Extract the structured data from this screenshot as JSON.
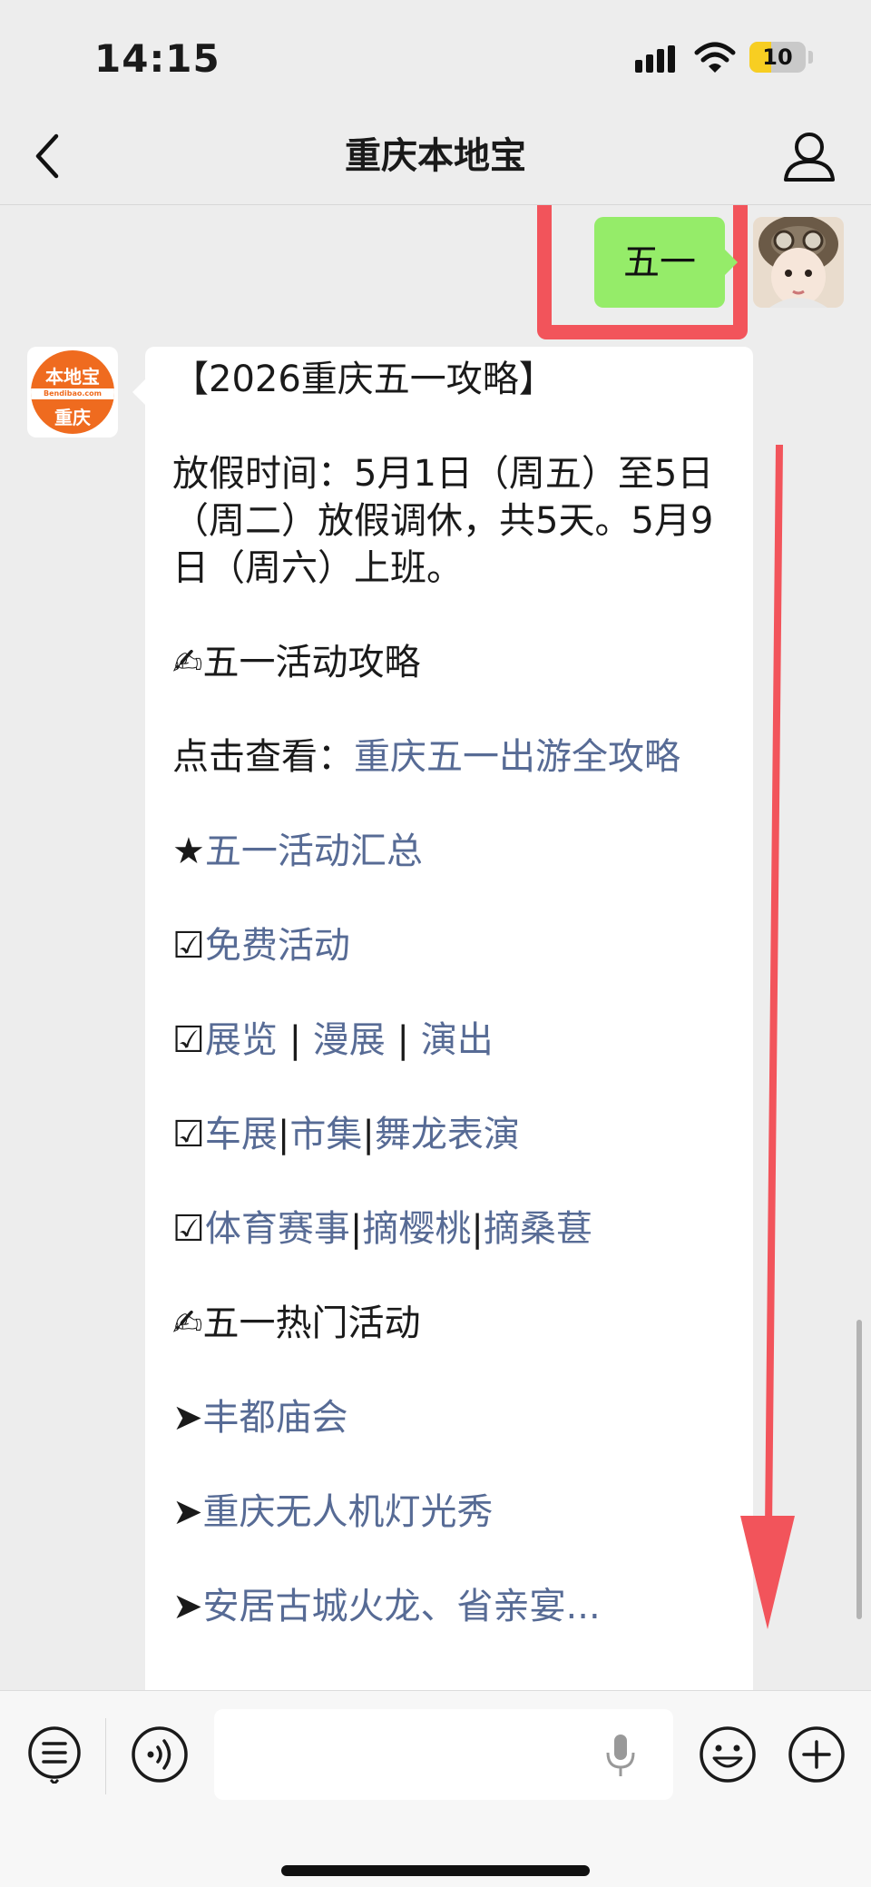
{
  "status": {
    "time": "14:15",
    "battery": "10"
  },
  "nav": {
    "title": "重庆本地宝"
  },
  "sent": {
    "text": "五一"
  },
  "bot": {
    "avatar_brand": "本地宝",
    "avatar_url": "Bendibao.com",
    "avatar_city": "重庆"
  },
  "message": {
    "title": "【2026重庆五一攻略】",
    "holiday": "放假时间：5月1日（周五）至5日（周二）放假调休，共5天。5月9日（周六）上班。",
    "holiday_lines": [
      "放假时间：5月1日（周五）至5日",
      "（周二）放假调休，共5天。5月9",
      "日（周六）上班。"
    ],
    "section1": "✍五一活动攻略",
    "guide_prefix": "点击查看：",
    "guide_link": "重庆五一出游全攻略",
    "star_prefix": "★",
    "star_link": "五一活动汇总",
    "check": "☑",
    "free_link": "免费活动",
    "exhibit_links": [
      "展览",
      "漫展",
      "演出"
    ],
    "car_links": [
      "车展",
      "市集",
      "舞龙表演"
    ],
    "sport_links": [
      "体育赛事",
      "摘樱桃",
      "摘桑葚"
    ],
    "separator": "|",
    "section2": "✍五一热门活动",
    "arrow": "➤",
    "hot_links": [
      "丰都庙会",
      "重庆无人机灯光秀",
      "安居古城火龙、省亲宴..."
    ]
  },
  "colors": {
    "link": "#576b95",
    "sent_bubble": "#95ec69",
    "annotation": "#f2545b",
    "background": "#ededed"
  },
  "icons": [
    "back-icon",
    "profile-icon",
    "menu-icon",
    "voice-icon",
    "mic-icon",
    "emoji-icon",
    "plus-icon"
  ]
}
